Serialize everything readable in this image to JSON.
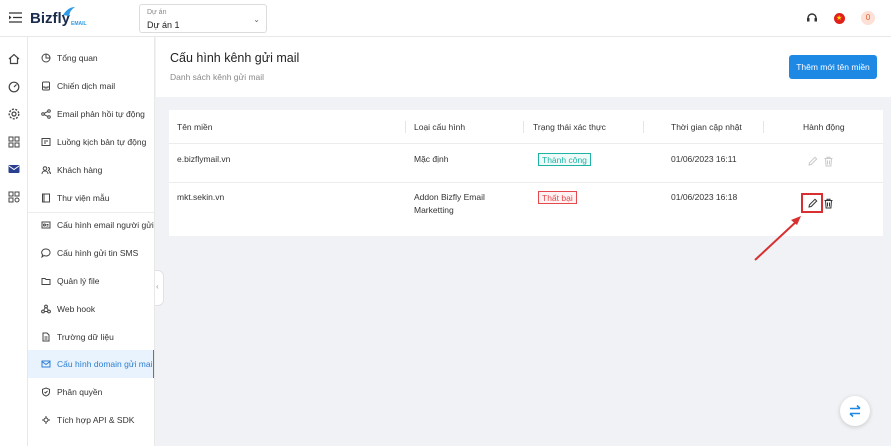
{
  "header": {
    "logo_text": "Bizfly",
    "logo_sub": "EMAIL",
    "project_label": "Dự án",
    "project_value": "Dự án 1",
    "notification_count": "0"
  },
  "sidebar": {
    "items": [
      {
        "label": "Tổng quan",
        "icon": "pie-chart-icon"
      },
      {
        "label": "Chiến dịch mail",
        "icon": "inbox-icon"
      },
      {
        "label": "Email phản hồi tự động",
        "icon": "share-icon"
      },
      {
        "label": "Luồng kịch bản tự động",
        "icon": "flow-icon"
      },
      {
        "label": "Khách hàng",
        "icon": "users-icon"
      },
      {
        "label": "Thư viện mẫu",
        "icon": "library-icon"
      },
      {
        "label": "Cấu hình email người gửi",
        "icon": "mail-card-icon"
      },
      {
        "label": "Cấu hình gửi tin SMS",
        "icon": "chat-icon"
      },
      {
        "label": "Quản lý file",
        "icon": "folder-icon"
      },
      {
        "label": "Web hook",
        "icon": "webhook-icon"
      },
      {
        "label": "Trường dữ liệu",
        "icon": "file-icon"
      },
      {
        "label": "Cấu hình domain gửi mail",
        "icon": "mail-icon"
      },
      {
        "label": "Phân quyền",
        "icon": "shield-icon"
      },
      {
        "label": "Tích hợp API & SDK",
        "icon": "api-icon"
      }
    ]
  },
  "page": {
    "title": "Cấu hình kênh gửi mail",
    "subtitle": "Danh sách kênh gửi mail",
    "add_button": "Thêm mới tên miền"
  },
  "table": {
    "headers": [
      "Tên miền",
      "Loại cấu hình",
      "Trạng thái xác thực",
      "Thời gian cập nhật",
      "Hành động"
    ],
    "rows": [
      {
        "domain": "e.bizflymail.vn",
        "type": "Mặc định",
        "status": "Thành công",
        "status_kind": "success",
        "updated": "01/06/2023 16:11"
      },
      {
        "domain": "mkt.sekin.vn",
        "type": "Addon Bizfly Email Marketting",
        "status": "Thất bại",
        "status_kind": "failed",
        "updated": "01/06/2023 16:18"
      }
    ]
  },
  "colors": {
    "primary": "#1e88e5",
    "success": "#1fb3a5",
    "danger": "#e5484d"
  }
}
